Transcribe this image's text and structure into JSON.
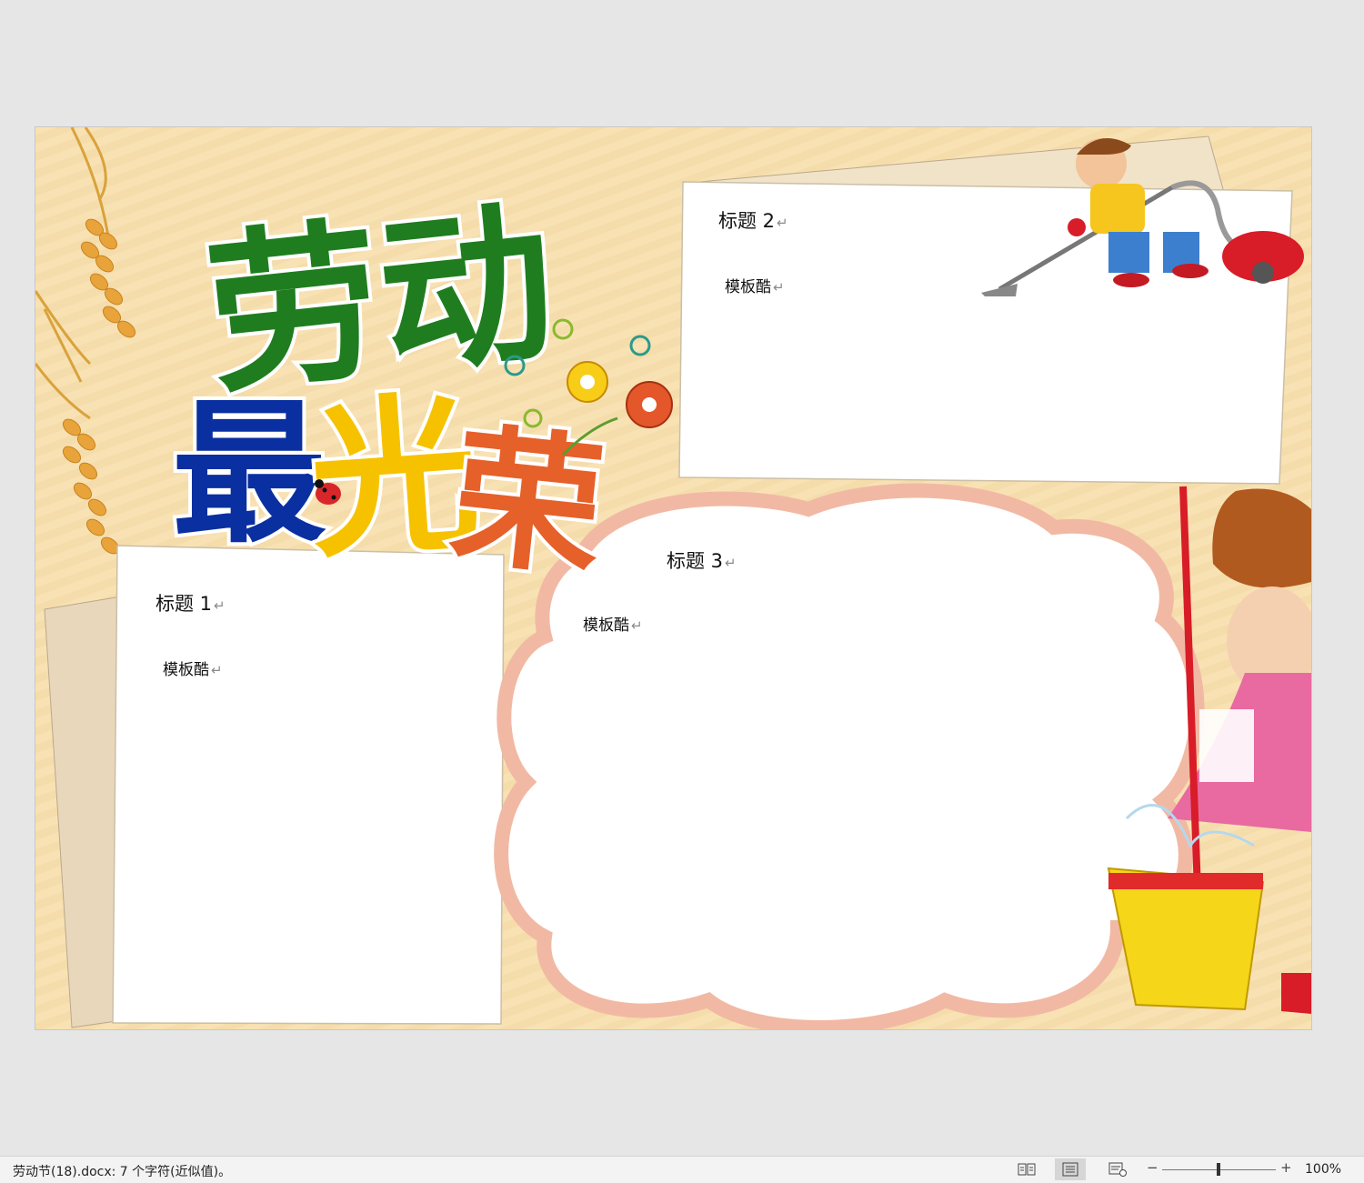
{
  "document": {
    "poster_title": "劳动最光荣",
    "sections": [
      {
        "heading": "标题 1",
        "body": "模板酷"
      },
      {
        "heading": "标题 2",
        "body": "模板酷"
      },
      {
        "heading": "标题 3",
        "body": "模板酷"
      }
    ],
    "paragraph_mark": "↵"
  },
  "statusbar": {
    "doc_info": "劳动节(18).docx: 7 个字符(近似值)。",
    "zoom_minus": "−",
    "zoom_plus": "+",
    "zoom_label": "100%",
    "zoom_level": 100,
    "views": [
      {
        "name": "read-mode",
        "icon": "book-icon",
        "active": false
      },
      {
        "name": "print-layout",
        "icon": "page-lines-icon",
        "active": true
      },
      {
        "name": "web-layout",
        "icon": "web-page-icon",
        "active": false
      }
    ]
  },
  "colors": {
    "background": "#f8e2b4",
    "title_green": "#1f7d1f",
    "title_blue": "#0a2fa0",
    "title_yellow": "#f6c200",
    "title_orange": "#e6602a",
    "cloud_border": "#f1b9a4"
  }
}
